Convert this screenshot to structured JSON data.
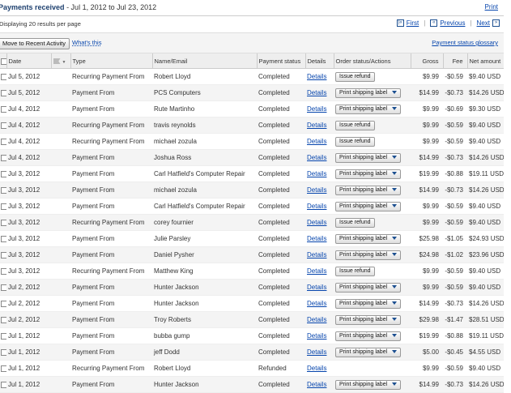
{
  "header": {
    "title": "Payments received",
    "date_range": " - Jul 1, 2012 to Jul 23, 2012",
    "print": "Print"
  },
  "results": {
    "text": "Displaying 20 results per page"
  },
  "pager": {
    "first": "First",
    "previous": "Previous",
    "next": "Next",
    "first_icon": "|«",
    "previous_icon": "«",
    "next_icon": "»",
    "last_icon": "»|"
  },
  "actions": {
    "move_button": "Move to Recent Activity",
    "whats_this": "What's this",
    "glossary": "Payment status glossary"
  },
  "columns": [
    "",
    "Date",
    "",
    "Type",
    "Name/Email",
    "Payment status",
    "Details",
    "Order status/Actions",
    "Gross",
    "Fee",
    "Net amount"
  ],
  "rows": [
    {
      "date": "Jul 5, 2012",
      "type": "Recurring Payment From",
      "name": "Robert Lloyd",
      "status": "Completed",
      "details": "Details",
      "action": "Issue refund",
      "gross": "$9.99",
      "fee": "-$0.59",
      "net": "$9.40 USD"
    },
    {
      "date": "Jul 5, 2012",
      "type": "Payment From",
      "name": "PCS Computers",
      "status": "Completed",
      "details": "Details",
      "action": "Print shipping label",
      "gross": "$14.99",
      "fee": "-$0.73",
      "net": "$14.26 USD"
    },
    {
      "date": "Jul 4, 2012",
      "type": "Payment From",
      "name": "Rute Martinho",
      "status": "Completed",
      "details": "Details",
      "action": "Print shipping label",
      "gross": "$9.99",
      "fee": "-$0.69",
      "net": "$9.30 USD"
    },
    {
      "date": "Jul 4, 2012",
      "type": "Recurring Payment From",
      "name": "travis reynolds",
      "status": "Completed",
      "details": "Details",
      "action": "Issue refund",
      "gross": "$9.99",
      "fee": "-$0.59",
      "net": "$9.40 USD"
    },
    {
      "date": "Jul 4, 2012",
      "type": "Recurring Payment From",
      "name": "michael zozula",
      "status": "Completed",
      "details": "Details",
      "action": "Issue refund",
      "gross": "$9.99",
      "fee": "-$0.59",
      "net": "$9.40 USD"
    },
    {
      "date": "Jul 4, 2012",
      "type": "Payment From",
      "name": "Joshua Ross",
      "status": "Completed",
      "details": "Details",
      "action": "Print shipping label",
      "gross": "$14.99",
      "fee": "-$0.73",
      "net": "$14.26 USD"
    },
    {
      "date": "Jul 3, 2012",
      "type": "Payment From",
      "name": "Carl Hatfield's Computer Repair",
      "status": "Completed",
      "details": "Details",
      "action": "Print shipping label",
      "gross": "$19.99",
      "fee": "-$0.88",
      "net": "$19.11 USD"
    },
    {
      "date": "Jul 3, 2012",
      "type": "Payment From",
      "name": "michael zozula",
      "status": "Completed",
      "details": "Details",
      "action": "Print shipping label",
      "gross": "$14.99",
      "fee": "-$0.73",
      "net": "$14.26 USD"
    },
    {
      "date": "Jul 3, 2012",
      "type": "Payment From",
      "name": "Carl Hatfield's Computer Repair",
      "status": "Completed",
      "details": "Details",
      "action": "Print shipping label",
      "gross": "$9.99",
      "fee": "-$0.59",
      "net": "$9.40 USD"
    },
    {
      "date": "Jul 3, 2012",
      "type": "Recurring Payment From",
      "name": "corey fournier",
      "status": "Completed",
      "details": "Details",
      "action": "Issue refund",
      "gross": "$9.99",
      "fee": "-$0.59",
      "net": "$9.40 USD"
    },
    {
      "date": "Jul 3, 2012",
      "type": "Payment From",
      "name": "Julie Parsley",
      "status": "Completed",
      "details": "Details",
      "action": "Print shipping label",
      "gross": "$25.98",
      "fee": "-$1.05",
      "net": "$24.93 USD"
    },
    {
      "date": "Jul 3, 2012",
      "type": "Payment From",
      "name": "Daniel Pysher",
      "status": "Completed",
      "details": "Details",
      "action": "Print shipping label",
      "gross": "$24.98",
      "fee": "-$1.02",
      "net": "$23.96 USD"
    },
    {
      "date": "Jul 3, 2012",
      "type": "Recurring Payment From",
      "name": "Matthew King",
      "status": "Completed",
      "details": "Details",
      "action": "Issue refund",
      "gross": "$9.99",
      "fee": "-$0.59",
      "net": "$9.40 USD"
    },
    {
      "date": "Jul 2, 2012",
      "type": "Payment From",
      "name": "Hunter Jackson",
      "status": "Completed",
      "details": "Details",
      "action": "Print shipping label",
      "gross": "$9.99",
      "fee": "-$0.59",
      "net": "$9.40 USD"
    },
    {
      "date": "Jul 2, 2012",
      "type": "Payment From",
      "name": "Hunter Jackson",
      "status": "Completed",
      "details": "Details",
      "action": "Print shipping label",
      "gross": "$14.99",
      "fee": "-$0.73",
      "net": "$14.26 USD"
    },
    {
      "date": "Jul 2, 2012",
      "type": "Payment From",
      "name": "Troy Roberts",
      "status": "Completed",
      "details": "Details",
      "action": "Print shipping label",
      "gross": "$29.98",
      "fee": "-$1.47",
      "net": "$28.51 USD"
    },
    {
      "date": "Jul 1, 2012",
      "type": "Payment From",
      "name": "bubba gump",
      "status": "Completed",
      "details": "Details",
      "action": "Print shipping label",
      "gross": "$19.99",
      "fee": "-$0.88",
      "net": "$19.11 USD"
    },
    {
      "date": "Jul 1, 2012",
      "type": "Payment From",
      "name": "jeff Dodd",
      "status": "Completed",
      "details": "Details",
      "action": "Print shipping label",
      "gross": "$5.00",
      "fee": "-$0.45",
      "net": "$4.55 USD"
    },
    {
      "date": "Jul 1, 2012",
      "type": "Recurring Payment From",
      "name": "Robert Lloyd",
      "status": "Refunded",
      "details": "Details",
      "action": "",
      "gross": "$9.99",
      "fee": "-$0.59",
      "net": "$9.40 USD"
    },
    {
      "date": "Jul 1, 2012",
      "type": "Payment From",
      "name": "Hunter Jackson",
      "status": "Completed",
      "details": "Details",
      "action": "Print shipping label",
      "gross": "$14.99",
      "fee": "-$0.73",
      "net": "$14.26 USD"
    }
  ]
}
